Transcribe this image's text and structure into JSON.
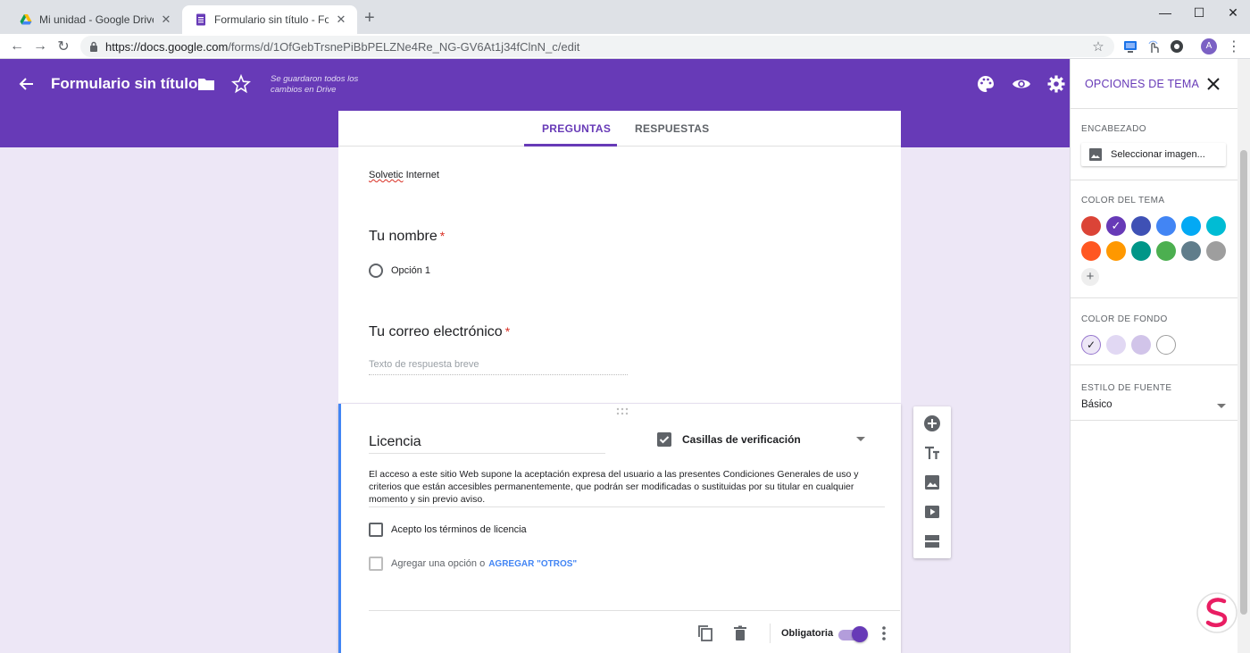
{
  "browser": {
    "tabs": [
      {
        "title": "Mi unidad - Google Drive",
        "icon": "google-drive-icon"
      },
      {
        "title": "Formulario sin título - Formularios de Google",
        "icon": "google-forms-icon"
      }
    ],
    "url_host": "https://docs.google.com",
    "url_path": "/forms/d/1OfGebTrsnePiBbPELZNe4Re_NG-GV6At1j34fClnN_c/edit",
    "profile_initial": "A"
  },
  "header": {
    "title": "Formulario sin título",
    "saved_note": "Se guardaron todos los cambios en Drive",
    "color": "#673ab7"
  },
  "form_tabs": [
    "PREGUNTAS",
    "RESPUESTAS"
  ],
  "form": {
    "desc_part1": "Solvetic",
    "desc_part2": " Internet",
    "q1_title": "Tu nombre",
    "q1_option": "Opción 1",
    "q2_title": "Tu correo electrónico",
    "q2_placeholder": "Texto de respuesta breve",
    "required_mark": "*"
  },
  "active_question": {
    "title": "Licencia",
    "type": "Casillas de verificación",
    "description": "El acceso a este sitio Web supone la aceptación expresa del usuario a las presentes Condiciones Generales de uso y criterios que están accesibles permanentemente, que podrán ser modificadas o sustituidas por su titular en cualquier momento y sin previo aviso.",
    "option1": "Acepto los términos de licencia",
    "add_option": "Agregar una opción",
    "add_or": "o",
    "add_other": "AGREGAR \"OTROS\"",
    "required_label": "Obligatoria",
    "required_on": true
  },
  "theme_panel": {
    "title": "OPCIONES DE TEMA",
    "header_label": "ENCABEZADO",
    "select_image": "Seleccionar imagen...",
    "theme_color_label": "COLOR DEL TEMA",
    "theme_colors": [
      "#db4437",
      "#673ab7",
      "#3f51b5",
      "#4285f4",
      "#03a9f4",
      "#00bcd4",
      "#ff5722",
      "#ff9800",
      "#009688",
      "#4caf50",
      "#607d8b",
      "#9e9e9e"
    ],
    "selected_theme_color": "#673ab7",
    "bg_color_label": "COLOR DE FONDO",
    "bg_colors": [
      "#ede7f6",
      "#e1d8f3",
      "#d1c4e9",
      "#ffffff"
    ],
    "font_label": "ESTILO DE FUENTE",
    "font_value": "Básico"
  }
}
